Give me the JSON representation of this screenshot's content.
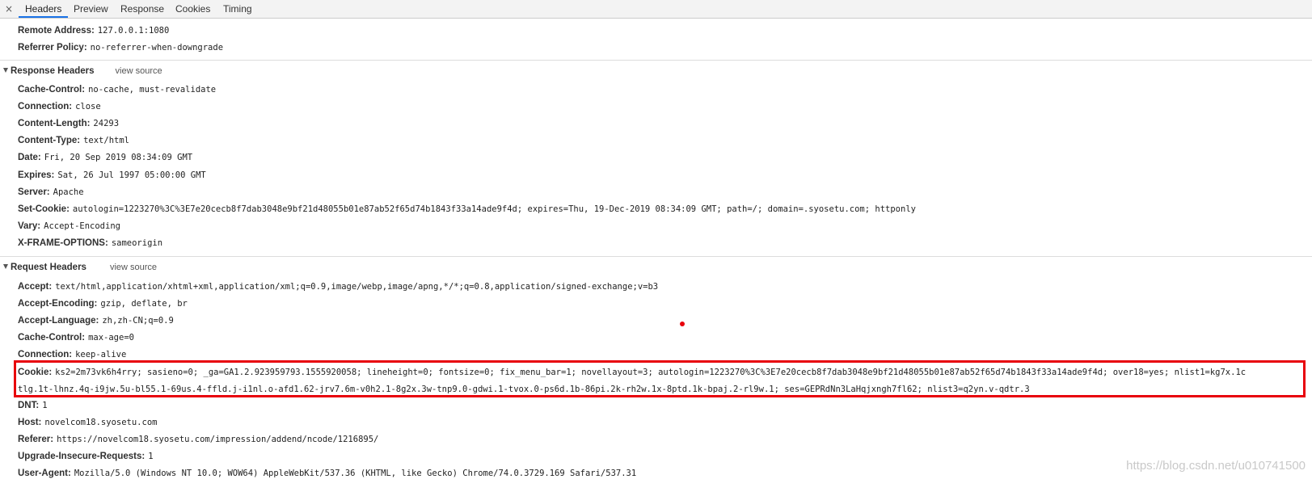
{
  "tabs": [
    {
      "label": "Headers",
      "active": true
    },
    {
      "label": "Preview",
      "active": false
    },
    {
      "label": "Response",
      "active": false
    },
    {
      "label": "Cookies",
      "active": false
    },
    {
      "label": "Timing",
      "active": false
    }
  ],
  "close_glyph": "×",
  "general": [
    {
      "name": "Remote Address:",
      "value": "127.0.0.1:1080"
    },
    {
      "name": "Referrer Policy:",
      "value": "no-referrer-when-downgrade"
    }
  ],
  "response_section": {
    "title": "Response Headers",
    "view_source": "view source"
  },
  "response_headers": [
    {
      "name": "Cache-Control:",
      "value": "no-cache, must-revalidate"
    },
    {
      "name": "Connection:",
      "value": "close"
    },
    {
      "name": "Content-Length:",
      "value": "24293"
    },
    {
      "name": "Content-Type:",
      "value": "text/html"
    },
    {
      "name": "Date:",
      "value": "Fri, 20 Sep 2019 08:34:09 GMT"
    },
    {
      "name": "Expires:",
      "value": "Sat, 26 Jul 1997 05:00:00 GMT"
    },
    {
      "name": "Server:",
      "value": "Apache"
    },
    {
      "name": "Set-Cookie:",
      "value": "autologin=1223270%3C%3E7e20cecb8f7dab3048e9bf21d48055b01e87ab52f65d74b1843f33a14ade9f4d; expires=Thu, 19-Dec-2019 08:34:09 GMT; path=/; domain=.syosetu.com; httponly"
    },
    {
      "name": "Vary:",
      "value": "Accept-Encoding"
    },
    {
      "name": "X-FRAME-OPTIONS:",
      "value": "sameorigin"
    }
  ],
  "request_section": {
    "title": "Request Headers",
    "view_source": "view source"
  },
  "request_headers_top": [
    {
      "name": "Accept:",
      "value": "text/html,application/xhtml+xml,application/xml;q=0.9,image/webp,image/apng,*/*;q=0.8,application/signed-exchange;v=b3"
    },
    {
      "name": "Accept-Encoding:",
      "value": "gzip, deflate, br"
    },
    {
      "name": "Accept-Language:",
      "value": "zh,zh-CN;q=0.9"
    },
    {
      "name": "Cache-Control:",
      "value": "max-age=0"
    },
    {
      "name": "Connection:",
      "value": "keep-alive"
    }
  ],
  "cookie": {
    "name": "Cookie:",
    "line1": "ks2=2m73vk6h4rry; sasieno=0; _ga=GA1.2.923959793.1555920058; lineheight=0; fontsize=0; fix_menu_bar=1; novellayout=3; autologin=1223270%3C%3E7e20cecb8f7dab3048e9bf21d48055b01e87ab52f65d74b1843f33a14ade9f4d; over18=yes; nlist1=kg7x.1c",
    "line2": "tlg.1t-lhnz.4q-i9jw.5u-bl55.1-69us.4-ffld.j-i1nl.o-afd1.62-jrv7.6m-v0h2.1-8g2x.3w-tnp9.0-gdwi.1-tvox.0-ps6d.1b-86pi.2k-rh2w.1x-8ptd.1k-bpaj.2-rl9w.1; ses=GEPRdNn3LaHqjxngh7fl62; nlist3=q2yn.v-qdtr.3"
  },
  "request_headers_bottom": [
    {
      "name": "DNT:",
      "value": "1"
    },
    {
      "name": "Host:",
      "value": "novelcom18.syosetu.com"
    },
    {
      "name": "Referer:",
      "value": "https://novelcom18.syosetu.com/impression/addend/ncode/1216895/"
    },
    {
      "name": "Upgrade-Insecure-Requests:",
      "value": "1"
    },
    {
      "name": "User-Agent:",
      "value": "Mozilla/5.0 (Windows NT 10.0; WOW64) AppleWebKit/537.36 (KHTML, like Gecko) Chrome/74.0.3729.169 Safari/537.31"
    }
  ],
  "watermark": "https://blog.csdn.net/u010741500",
  "colors": {
    "highlight": "#e8000b",
    "active_tab": "#1a73e8"
  }
}
